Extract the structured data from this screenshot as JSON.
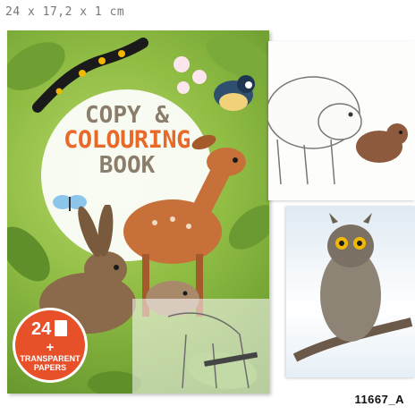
{
  "dimensions": "24 x 17,2 x 1 cm",
  "sku": "11667_A",
  "cover": {
    "title_line1": "COPY &",
    "title_line2": "COLOURING",
    "title_line3": "BOOK",
    "badge_count": "24",
    "badge_plus": "+",
    "badge_text": "TRANSPARENT PAPERS"
  },
  "colors": {
    "cover_green": "#8fbc43",
    "title_brown": "#8a7d6b",
    "title_orange": "#e86a2a",
    "badge_orange": "#e8502a"
  },
  "illustrations": [
    "salamander",
    "bird",
    "butterfly",
    "fawn",
    "hare",
    "fox",
    "polar-bear",
    "bear-cub",
    "owl"
  ]
}
